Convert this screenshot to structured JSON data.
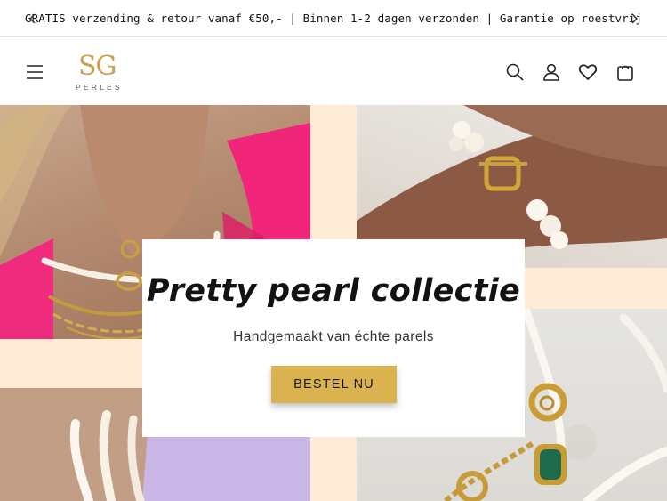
{
  "announcement": {
    "text": "GRATIS verzending & retour vanaf €50,- | Binnen 1-2 dagen verzonden | Garantie op roestvrij",
    "prev_icon": "chevron-left-icon",
    "next_icon": "chevron-right-icon"
  },
  "header": {
    "menu_icon": "hamburger-menu-icon",
    "logo": {
      "mark": "SG",
      "subtitle": "PERLES"
    },
    "icons": [
      "search-icon",
      "account-icon",
      "wishlist-heart-icon",
      "cart-bag-icon"
    ]
  },
  "hero": {
    "title": "Pretty pearl collectie",
    "subtitle": "Handgemaakt van échte parels",
    "cta_label": "BESTEL NU"
  },
  "colors": {
    "logo_gold": "#c9a14e",
    "cta_gold": "#dbb250",
    "hero_background": "#fdebd5",
    "text": "#121212"
  }
}
